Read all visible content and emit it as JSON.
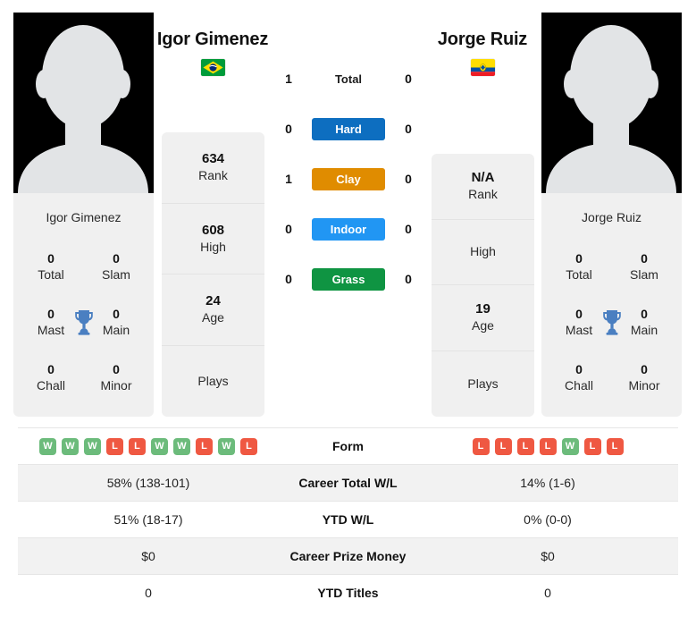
{
  "players": {
    "left": {
      "name": "Igor Gimenez",
      "card_name": "Igor Gimenez",
      "flag": "brazil-flag",
      "rank": "634",
      "rank_label": "Rank",
      "high": "608",
      "high_label": "High",
      "age": "24",
      "age_label": "Age",
      "plays": "",
      "plays_label": "Plays",
      "titles": {
        "total": "0",
        "total_label": "Total",
        "slam": "0",
        "slam_label": "Slam",
        "mast": "0",
        "mast_label": "Mast",
        "main": "0",
        "main_label": "Main",
        "chall": "0",
        "chall_label": "Chall",
        "minor": "0",
        "minor_label": "Minor"
      },
      "form": [
        "W",
        "W",
        "W",
        "L",
        "L",
        "W",
        "W",
        "L",
        "W",
        "L"
      ]
    },
    "right": {
      "name": "Jorge Ruiz",
      "card_name": "Jorge Ruiz",
      "flag": "ecuador-flag",
      "rank": "N/A",
      "rank_label": "Rank",
      "high": "",
      "high_label": "High",
      "age": "19",
      "age_label": "Age",
      "plays": "",
      "plays_label": "Plays",
      "titles": {
        "total": "0",
        "total_label": "Total",
        "slam": "0",
        "slam_label": "Slam",
        "mast": "0",
        "mast_label": "Mast",
        "main": "0",
        "main_label": "Main",
        "chall": "0",
        "chall_label": "Chall",
        "minor": "0",
        "minor_label": "Minor"
      },
      "form": [
        "L",
        "L",
        "L",
        "L",
        "W",
        "L",
        "L"
      ]
    }
  },
  "surfaces": [
    {
      "key": "total",
      "label": "Total",
      "left": "1",
      "right": "0",
      "color": "",
      "style": "plain"
    },
    {
      "key": "hard",
      "label": "Hard",
      "left": "0",
      "right": "0",
      "color": "#0d6ec0",
      "style": "badge"
    },
    {
      "key": "clay",
      "label": "Clay",
      "left": "1",
      "right": "0",
      "color": "#e08c00",
      "style": "badge"
    },
    {
      "key": "indoor",
      "label": "Indoor",
      "left": "0",
      "right": "0",
      "color": "#2196f3",
      "style": "badge"
    },
    {
      "key": "grass",
      "label": "Grass",
      "left": "0",
      "right": "0",
      "color": "#0f9442",
      "style": "badge"
    }
  ],
  "stats_table": [
    {
      "label": "Form",
      "left": "",
      "right": "",
      "type": "form"
    },
    {
      "label": "Career Total W/L",
      "left": "58% (138-101)",
      "right": "14% (1-6)",
      "type": "text"
    },
    {
      "label": "YTD W/L",
      "left": "51% (18-17)",
      "right": "0% (0-0)",
      "type": "text"
    },
    {
      "label": "Career Prize Money",
      "left": "$0",
      "right": "$0",
      "type": "text"
    },
    {
      "label": "YTD Titles",
      "left": "0",
      "right": "0",
      "type": "text"
    }
  ],
  "colors": {
    "win": "#6cbb7b",
    "loss": "#ef5842",
    "trophy": "#4a7fc1",
    "card_bg": "#f0f0f0",
    "row_alt": "#f2f2f2"
  }
}
